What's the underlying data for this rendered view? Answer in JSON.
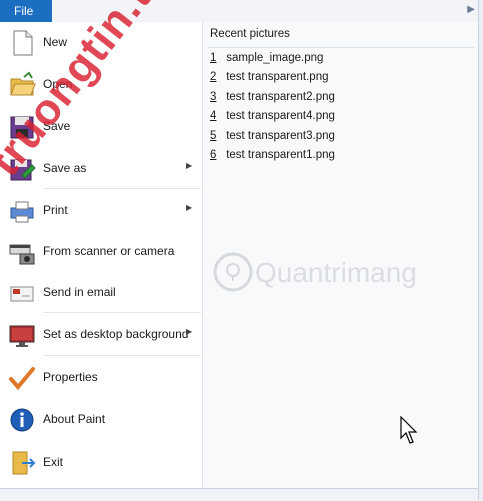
{
  "menu": {
    "file_tab": "File"
  },
  "left_menu": {
    "items": [
      {
        "key": "new",
        "label": "New"
      },
      {
        "key": "open",
        "label": "Open"
      },
      {
        "key": "save",
        "label": "Save"
      },
      {
        "key": "saveas",
        "label": "Save as"
      },
      {
        "key": "print",
        "label": "Print"
      },
      {
        "key": "scanner",
        "label": "From scanner or camera"
      },
      {
        "key": "email",
        "label": "Send in email"
      },
      {
        "key": "desktop",
        "label": "Set as desktop background"
      },
      {
        "key": "properties",
        "label": "Properties"
      },
      {
        "key": "about",
        "label": "About Paint"
      },
      {
        "key": "exit",
        "label": "Exit"
      }
    ]
  },
  "recent": {
    "title": "Recent pictures",
    "items": [
      {
        "num": "1",
        "name": "sample_image.png"
      },
      {
        "num": "2",
        "name": "test transparent.png"
      },
      {
        "num": "3",
        "name": "test transparent2.png"
      },
      {
        "num": "4",
        "name": "test transparent4.png"
      },
      {
        "num": "5",
        "name": "test transparent3.png"
      },
      {
        "num": "6",
        "name": "test transparent1.png"
      }
    ]
  },
  "watermarks": {
    "diagonal": "truongtin.top",
    "logo": "Quantrimang"
  },
  "colors": {
    "file_tab": "#1c6ec0",
    "watermark_red": "#d8202f",
    "pane_bg": "#f8f9fb"
  }
}
